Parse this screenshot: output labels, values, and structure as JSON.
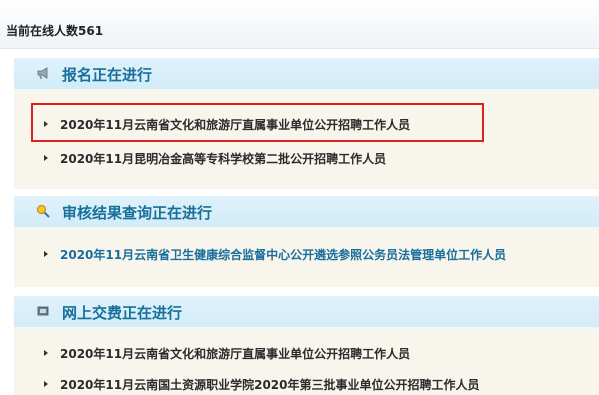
{
  "online": {
    "label": "当前在线人数561"
  },
  "sections": [
    {
      "title": "报名正在进行",
      "icon": "megaphone-icon",
      "items": [
        "2020年11月云南省文化和旅游厅直属事业单位公开招聘工作人员",
        "2020年11月昆明冶金高等专科学校第二批公开招聘工作人员"
      ]
    },
    {
      "title": "审核结果查询正在进行",
      "icon": "magnifier-icon",
      "items": [
        "2020年11月云南省卫生健康综合监督中心公开遴选参照公务员法管理单位工作人员"
      ]
    },
    {
      "title": "网上交费正在进行",
      "icon": "payment-icon",
      "items": [
        "2020年11月云南省文化和旅游厅直属事业单位公开招聘工作人员",
        "2020年11月云南国土资源职业学院2020年第三批事业单位公开招聘工作人员"
      ]
    }
  ],
  "colors": {
    "accent": "#17709a",
    "highlight": "#e0201b",
    "panel": "#f8f5ec",
    "header": "#d2ecf9"
  }
}
